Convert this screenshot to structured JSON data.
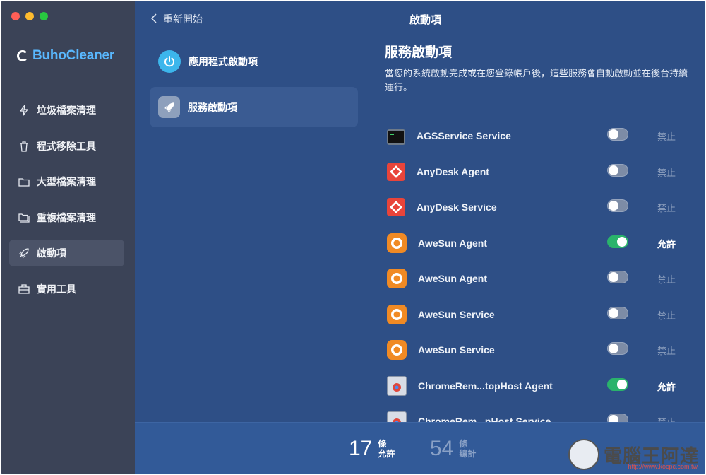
{
  "sidebar": {
    "brand": "BuhoCleaner",
    "items": [
      {
        "label": "垃圾檔案清理",
        "icon": "lightning-icon",
        "active": false
      },
      {
        "label": "程式移除工具",
        "icon": "trash-icon",
        "active": false
      },
      {
        "label": "大型檔案清理",
        "icon": "folder-icon",
        "active": false
      },
      {
        "label": "重複檔案清理",
        "icon": "duplicate-folder-icon",
        "active": false
      },
      {
        "label": "啟動項",
        "icon": "rocket-icon",
        "active": true
      },
      {
        "label": "實用工具",
        "icon": "toolbox-icon",
        "active": false
      }
    ]
  },
  "header": {
    "back_label": "重新開始",
    "title": "啟動項"
  },
  "subnav": [
    {
      "label": "應用程式啟動項",
      "icon": "power-icon",
      "active": false
    },
    {
      "label": "服務啟動項",
      "icon": "rocket-icon",
      "active": true
    }
  ],
  "section": {
    "title": "服務啟動項",
    "description": "當您的系統啟動完成或在您登錄帳戶後，這些服務會自動啟動並在後台持續運行。"
  },
  "services": [
    {
      "name": "AGSService Service",
      "icon": "terminal-icon",
      "enabled": false,
      "status": "禁止"
    },
    {
      "name": "AnyDesk Agent",
      "icon": "anydesk-icon",
      "enabled": false,
      "status": "禁止"
    },
    {
      "name": "AnyDesk Service",
      "icon": "anydesk-icon",
      "enabled": false,
      "status": "禁止"
    },
    {
      "name": "AweSun Agent",
      "icon": "awesun-icon",
      "enabled": true,
      "status": "允許"
    },
    {
      "name": "AweSun Agent",
      "icon": "awesun-icon",
      "enabled": false,
      "status": "禁止"
    },
    {
      "name": "AweSun Service",
      "icon": "awesun-icon",
      "enabled": false,
      "status": "禁止"
    },
    {
      "name": "AweSun Service",
      "icon": "awesun-icon",
      "enabled": false,
      "status": "禁止"
    },
    {
      "name": "ChromeRem...topHost Agent",
      "icon": "chrome-remote-icon",
      "enabled": true,
      "status": "允許"
    },
    {
      "name": "ChromeRem...pHost Service",
      "icon": "chrome-remote-icon",
      "enabled": false,
      "status": "禁止"
    }
  ],
  "footer": {
    "allowed_count": "17",
    "allowed_unit": "條",
    "allowed_label": "允許",
    "total_count": "54",
    "total_unit": "條",
    "total_label": "總計"
  },
  "watermark": {
    "text": "電腦王阿達",
    "url": "http://www.kocpc.com.tw"
  },
  "colors": {
    "sidebar_bg": "#3b4357",
    "main_bg": "#2e4f86",
    "brand_blue": "#59b8ff",
    "toggle_on": "#2ab36b"
  }
}
